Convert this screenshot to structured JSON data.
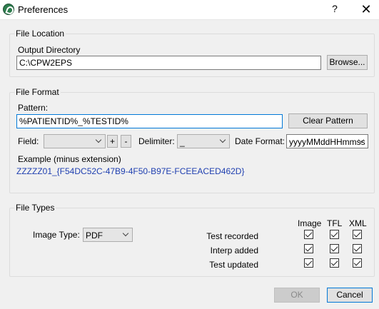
{
  "window": {
    "title": "Preferences",
    "help_label": "?",
    "close_label": "✕",
    "icon": "app-logo-icon"
  },
  "file_location": {
    "legend": "File Location",
    "output_dir_label": "Output Directory",
    "output_dir_value": "C:\\CPW2EPS",
    "browse_label": "Browse..."
  },
  "file_format": {
    "legend": "File Format",
    "pattern_label": "Pattern:",
    "pattern_value": "%PATIENTID%_%TESTID%",
    "clear_pattern_label": "Clear Pattern",
    "field_label": "Field:",
    "field_value": "",
    "add_label": "+",
    "remove_label": "-",
    "delimiter_label": "Delimiter:",
    "delimiter_value": "_",
    "date_format_label": "Date Format:",
    "date_format_value": "yyyyMMddHHmmss",
    "example_label": "Example (minus extension)",
    "example_value": "ZZZZZ01_{F54DC52C-47B9-4F50-B97E-FCEEACED462D}"
  },
  "file_types": {
    "legend": "File Types",
    "image_type_label": "Image Type:",
    "image_type_value": "PDF",
    "columns": [
      "Image",
      "TFL",
      "XML"
    ],
    "rows": [
      {
        "label": "Test recorded",
        "checked": [
          true,
          true,
          true
        ]
      },
      {
        "label": "Interp added",
        "checked": [
          true,
          true,
          true
        ]
      },
      {
        "label": "Test updated",
        "checked": [
          true,
          true,
          true
        ]
      }
    ]
  },
  "footer": {
    "ok_label": "OK",
    "cancel_label": "Cancel"
  }
}
